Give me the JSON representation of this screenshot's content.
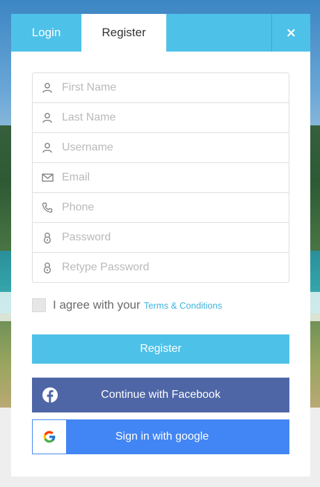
{
  "tabs": {
    "login": "Login",
    "register": "Register",
    "close": "×"
  },
  "fields": [
    {
      "placeholder": "First Name",
      "icon": "user-icon"
    },
    {
      "placeholder": "Last Name",
      "icon": "user-icon"
    },
    {
      "placeholder": "Username",
      "icon": "user-icon"
    },
    {
      "placeholder": "Email",
      "icon": "envelope-icon"
    },
    {
      "placeholder": "Phone",
      "icon": "phone-icon"
    },
    {
      "placeholder": "Password",
      "icon": "lock-icon"
    },
    {
      "placeholder": "Retype Password",
      "icon": "lock-icon"
    }
  ],
  "agree": {
    "text": "I agree with your",
    "link": "Terms & Conditions",
    "checked": false
  },
  "buttons": {
    "register": "Register",
    "facebook": "Continue with Facebook",
    "google": "Sign in with google"
  },
  "colors": {
    "accent": "#4ec1e8",
    "facebook": "#4f66a6",
    "google": "#4285f4",
    "link": "#3fb3dc"
  }
}
